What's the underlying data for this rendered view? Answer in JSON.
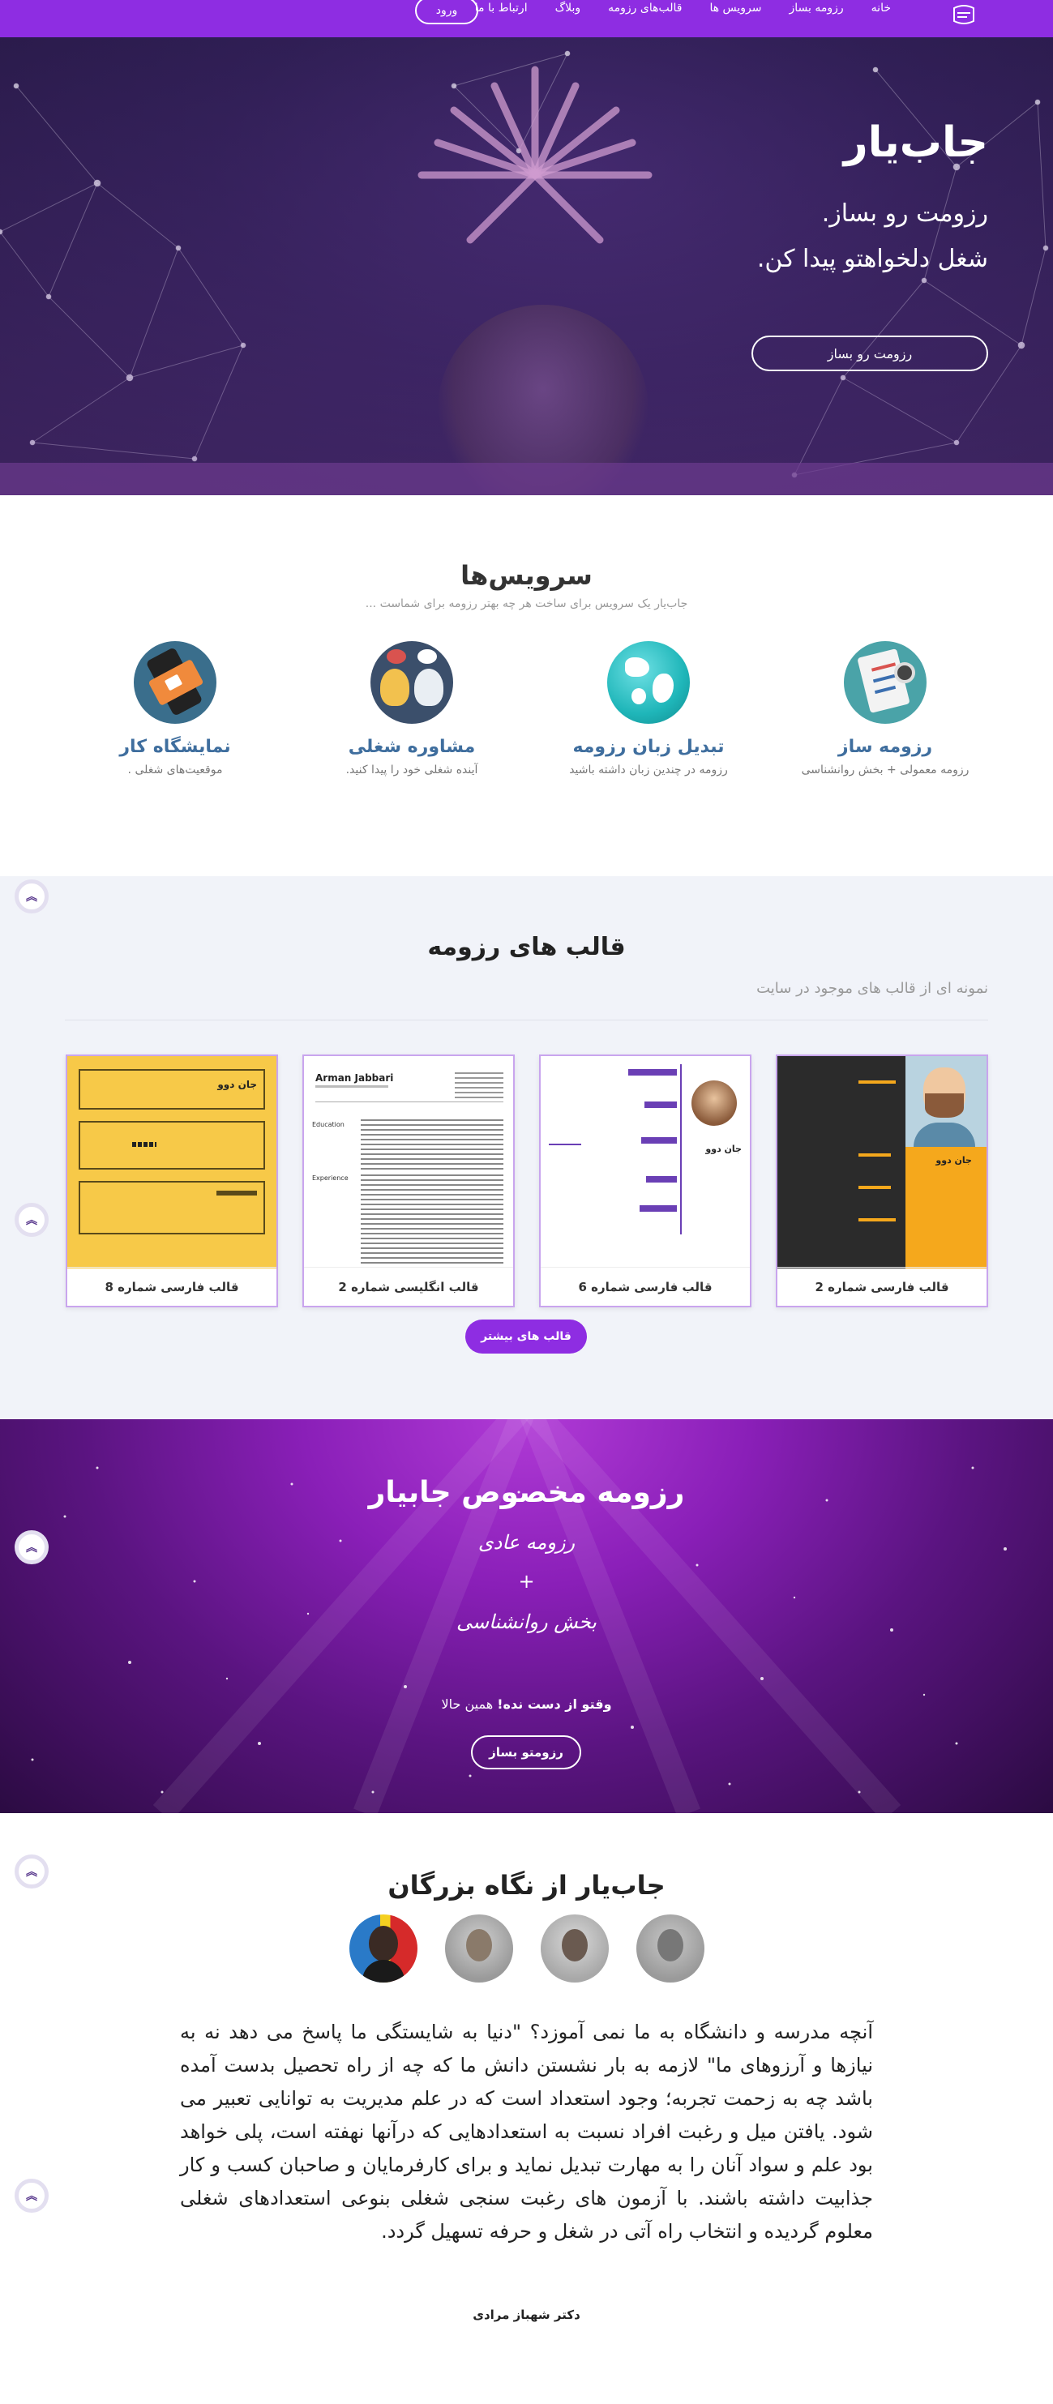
{
  "nav": {
    "links": [
      "خانه",
      "رزومه بساز",
      "سرویس ها",
      "قالب‌های رزومه",
      "وبلاگ",
      "ارتباط با ما"
    ],
    "login": "ورود"
  },
  "hero": {
    "title": "جاب‌یار",
    "line1": "رزومت رو بساز.",
    "line2": "شغل دلخواهتو پیدا کن.",
    "cta": "رزومت رو بساز"
  },
  "services": {
    "title": "سرویس‌ها",
    "lead": "جاب‌یار یک سرویس برای ساخت هر چه بهتر رزومه برای شماست ...",
    "items": [
      {
        "title": "رزومه ساز",
        "desc": "رزومه معمولی + بخش روانشناسی",
        "icon": "clipboard-icon"
      },
      {
        "title": "تبدیل زبان رزومه",
        "desc": "رزومه در چندین زبان داشته باشید",
        "icon": "globe-icon"
      },
      {
        "title": "مشاوره شغلی",
        "desc": "آینده شغلی خود را پیدا کنید.",
        "icon": "consult-icon"
      },
      {
        "title": "نمایشگاه کار",
        "desc": "موقعیت‌های شغلی .",
        "icon": "phone-icon"
      }
    ]
  },
  "templates": {
    "title": "قالب های رزومه",
    "lead": "نمونه ای از قالب های موجود در سایت",
    "cards": [
      {
        "caption": "قالب فارسی شماره 2"
      },
      {
        "caption": "قالب فارسی شماره 6"
      },
      {
        "caption": "قالب انگلیسی شماره 2"
      },
      {
        "caption": "قالب فارسی شماره 8"
      }
    ],
    "preview_texts": {
      "name_fa": "جان دوو",
      "name_en": "Arman Jabbari",
      "sec_education": "Education",
      "sec_experience": "Experience"
    },
    "more": "قالب های بیشتر"
  },
  "special": {
    "title": "رزومه مخصوص جابیار",
    "line1": "رزومه عادی",
    "plus": "+",
    "line2": "بخش روانشناسی",
    "act_bold": "وقتو از دست نده!",
    "act_rest": " همین حالا",
    "button": "رزومتو بساز"
  },
  "testimonial": {
    "title": "جاب‌یار از نگاه بزرگان",
    "quote": "آنچه مدرسه و دانشگاه به ما نمی آموزد؟ \"دنیا به شایستگی ما پاسخ می دهد نه به نیازها و آرزوهای ما\" لازمه به بار نشستن دانش ما که چه از راه تحصیل بدست آمده باشد چه به زحمت تجربه؛ وجود استعداد است که در علم مدیریت به توانایی تعبیر می شود. یافتن میل و رغبت افراد نسبت به استعدادهایی که درآنها نهفته است، پلی خواهد بود علم و سواد آنان را به مهارت تبدیل نماید و برای کارفرمایان و صاحبان کسب و کار جذابیت داشته باشند. با آزمون های رغبت سنجی شغلی بنوعی استعدادهای شغلی معلوم گردیده و انتخاب راه آتی در شغل و حرفه تسهیل گردد.",
    "author": "دکتر شهباز مرادی"
  },
  "colors": {
    "brand": "#8e2de2",
    "service_title": "#3f6e9e",
    "card_border": "#c9a5ee"
  }
}
